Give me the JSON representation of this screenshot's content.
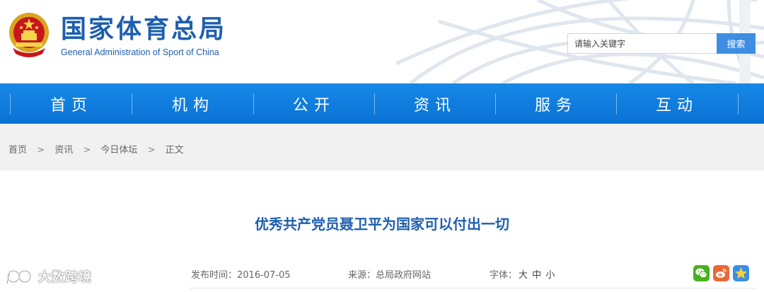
{
  "header": {
    "title_cn": "国家体育总局",
    "title_en": "General Administration of Sport of China",
    "emblem_icon": "national-emblem-icon"
  },
  "search": {
    "placeholder": "请输入关键字",
    "button_label": "搜索"
  },
  "nav": {
    "items": [
      {
        "label": "首页"
      },
      {
        "label": "机构"
      },
      {
        "label": "公开"
      },
      {
        "label": "资讯"
      },
      {
        "label": "服务"
      },
      {
        "label": "互动"
      }
    ]
  },
  "breadcrumb": {
    "items": [
      "首页",
      "资讯",
      "今日体坛",
      "正文"
    ],
    "separator": ">"
  },
  "article": {
    "title": "优秀共产党员聂卫平为国家可以付出一切",
    "publish_label": "发布时间：2016-07-05",
    "source_label": "来源：总局政府网站",
    "font_label": "字体：",
    "font_sizes": [
      "大",
      "中",
      "小"
    ]
  },
  "share": {
    "icons": [
      "wechat-icon",
      "weibo-icon",
      "star-icon"
    ]
  },
  "watermark": {
    "text": "大数跨境"
  },
  "colors": {
    "brand_blue": "#1e5fae",
    "nav_blue": "#0d7ad9",
    "search_button": "#3d8ee3",
    "breadcrumb_bg": "#f1f1f1",
    "wechat_green": "#47b21f",
    "weibo_orange": "#e9683a",
    "star_blue": "#3d8ee3"
  }
}
